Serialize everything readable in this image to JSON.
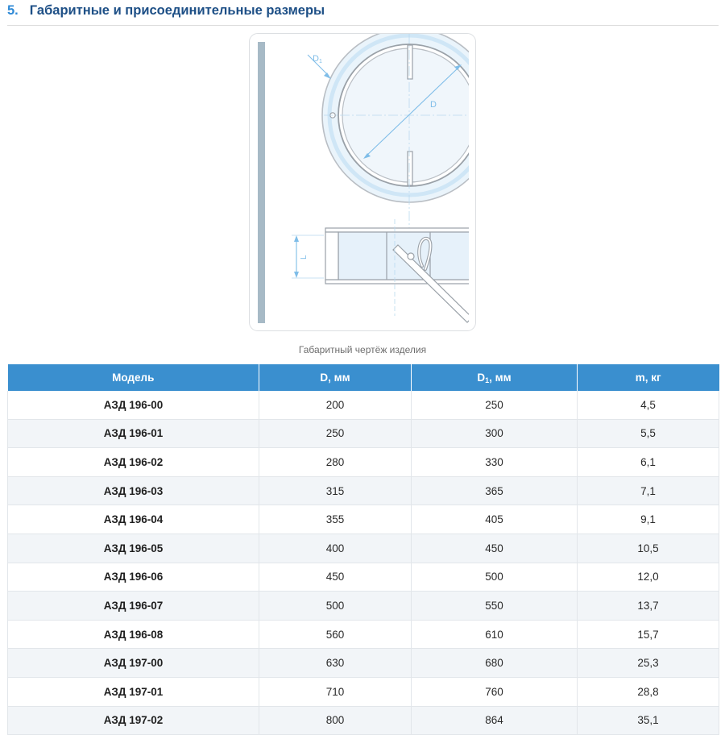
{
  "section": {
    "number": "5.",
    "title": "Габаритные и присоединительные размеры"
  },
  "drawing": {
    "label_d1": "D",
    "label_d1_sub": "1",
    "label_d": "D",
    "label_l": "L",
    "caption": "Габаритный чертёж изделия"
  },
  "table": {
    "headers": {
      "model": "Модель",
      "d": "D, мм",
      "d1_main": "D",
      "d1_sub": "1",
      "d1_unit": ", мм",
      "m": "m, кг"
    },
    "rows": [
      {
        "model": "АЗД 196-00",
        "d": "200",
        "d1": "250",
        "m": "4,5"
      },
      {
        "model": "АЗД 196-01",
        "d": "250",
        "d1": "300",
        "m": "5,5"
      },
      {
        "model": "АЗД 196-02",
        "d": "280",
        "d1": "330",
        "m": "6,1"
      },
      {
        "model": "АЗД 196-03",
        "d": "315",
        "d1": "365",
        "m": "7,1"
      },
      {
        "model": "АЗД 196-04",
        "d": "355",
        "d1": "405",
        "m": "9,1"
      },
      {
        "model": "АЗД 196-05",
        "d": "400",
        "d1": "450",
        "m": "10,5"
      },
      {
        "model": "АЗД 196-06",
        "d": "450",
        "d1": "500",
        "m": "12,0"
      },
      {
        "model": "АЗД 196-07",
        "d": "500",
        "d1": "550",
        "m": "13,7"
      },
      {
        "model": "АЗД 196-08",
        "d": "560",
        "d1": "610",
        "m": "15,7"
      },
      {
        "model": "АЗД 197-00",
        "d": "630",
        "d1": "680",
        "m": "25,3"
      },
      {
        "model": "АЗД 197-01",
        "d": "710",
        "d1": "760",
        "m": "28,8"
      },
      {
        "model": "АЗД 197-02",
        "d": "800",
        "d1": "864",
        "m": "35,1"
      }
    ]
  },
  "colors": {
    "heading": "#1d4f86",
    "heading_number": "#2f8ad6",
    "table_header": "#3a8fcf",
    "dimension_lines": "#8ec7ec",
    "body_outline": "#b9bec4"
  }
}
